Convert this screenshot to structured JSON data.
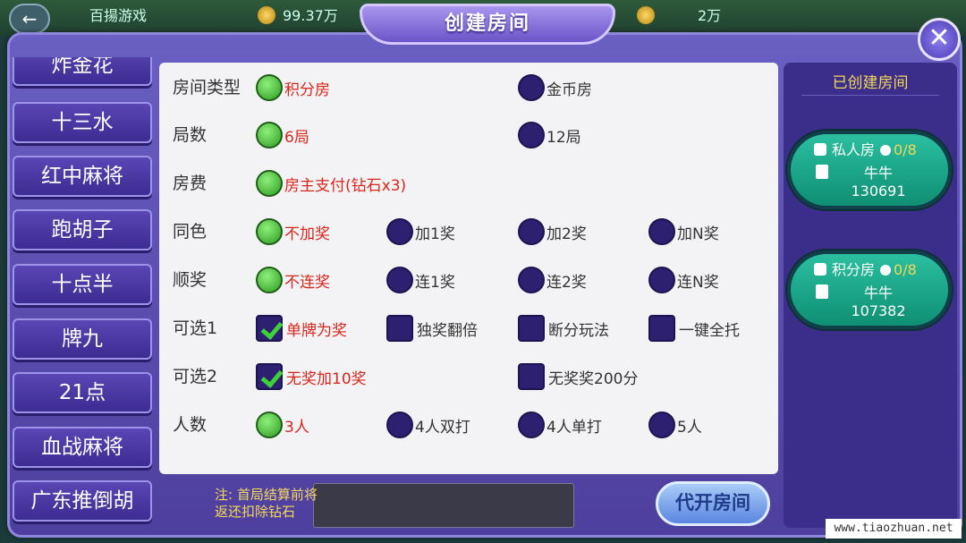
{
  "background": {
    "back_icon": "back-arrow-icon",
    "game_name": "百揚游戏",
    "coins": "99.37万",
    "other": "2万"
  },
  "dialog": {
    "title": "创建房间",
    "close_icon": "close-icon"
  },
  "games": [
    "炸金花",
    "十三水",
    "红中麻将",
    "跑胡子",
    "十点半",
    "牌九",
    "21点",
    "血战麻将",
    "广东推倒胡"
  ],
  "options": {
    "room_type": {
      "label": "房间类型",
      "a": "积分房",
      "b": "金币房"
    },
    "rounds": {
      "label": "局数",
      "a": "6局",
      "b": "12局"
    },
    "fee": {
      "label": "房费",
      "a": "房主支付(钻石x3)"
    },
    "same_color": {
      "label": "同色",
      "a": "不加奖",
      "b": "加1奖",
      "c": "加2奖",
      "d": "加N奖"
    },
    "straight": {
      "label": "顺奖",
      "a": "不连奖",
      "b": "连1奖",
      "c": "连2奖",
      "d": "连N奖"
    },
    "optional1": {
      "label": "可选1",
      "a": "单牌为奖",
      "b": "独奖翻倍",
      "c": "断分玩法",
      "d": "一键全托"
    },
    "optional2": {
      "label": "可选2",
      "a": "无奖加10奖",
      "b": "无奖奖200分"
    },
    "players": {
      "label": "人数",
      "a": "3人",
      "b": "4人双打",
      "c": "4人单打",
      "d": "5人"
    }
  },
  "footer": {
    "note_line1": "注: 首局结算前将",
    "note_line2": "返还扣除钻石",
    "proxy_button": "代开房间"
  },
  "created_rooms": {
    "title": "已创建房间",
    "rooms": [
      {
        "type": "私人房",
        "count": "0/8",
        "game": "牛牛",
        "id": "130691"
      },
      {
        "type": "积分房",
        "count": "0/8",
        "game": "牛牛",
        "id": "107382"
      }
    ]
  },
  "watermark": "www.tiaozhuan.net"
}
